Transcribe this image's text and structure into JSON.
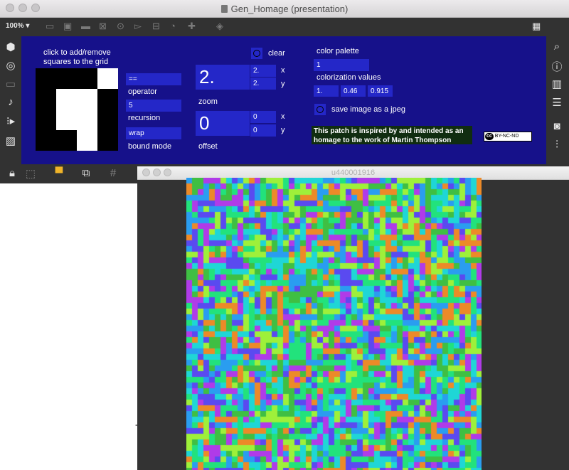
{
  "window": {
    "title": "Gen_Homage (presentation)",
    "zoom_label": "100% ▾"
  },
  "toolbar_icons": [
    "new-object-icon",
    "message-icon",
    "comment-icon",
    "button-icon",
    "toggle-icon",
    "number-icon",
    "slider-icon",
    "dial-icon",
    "add-icon",
    "paint-icon",
    "keyboard-icon"
  ],
  "left_sidebar_icons": [
    "cube-icon",
    "target-icon",
    "video-icon",
    "music-note-icon",
    "sequence-icon",
    "image-icon"
  ],
  "right_sidebar_icons": [
    "search-icon",
    "info-icon",
    "book-icon",
    "list-icon",
    "camera-icon",
    "mixer-icon"
  ],
  "bottom_bar_icons": [
    "lock-icon",
    "presentation-icon",
    "monitor-icon",
    "windows-icon",
    "grid-icon",
    "power-icon"
  ],
  "patch": {
    "grid_instructions": "click to add/remove squares to the grid",
    "grid_cells_on": [
      [
        0,
        0
      ],
      [
        1,
        0
      ],
      [
        2,
        0
      ],
      [
        0,
        1
      ],
      [
        3,
        1
      ],
      [
        0,
        2
      ],
      [
        3,
        2
      ],
      [
        0,
        3
      ],
      [
        1,
        3
      ],
      [
        3,
        3
      ]
    ],
    "operator_value": "==",
    "operator_label": "operator",
    "recursion_value": "5",
    "recursion_label": "recursion",
    "bound_mode_value": "wrap",
    "bound_mode_label": "bound mode",
    "zoom_big": "2.",
    "zoom_x": "2.",
    "zoom_y": "2.",
    "zoom_label": "zoom",
    "offset_big": "0",
    "offset_x": "0",
    "offset_y": "0",
    "offset_label": "offset",
    "x_label": "x",
    "y_label": "y",
    "clear_label": "clear",
    "color_palette_label": "color palette",
    "color_palette_value": "1",
    "colorization_label": "colorization values",
    "colorization_values": [
      "1.",
      "0.46",
      "0.915"
    ],
    "save_label": "save image as a jpeg",
    "note_text": "This patch is inspired by and intended as an homage to the work of Martin Thompson",
    "license_badge": "BY-NC-ND",
    "license_cc": "cc"
  },
  "output_window": {
    "title": "u440001916",
    "palette": [
      "#3fbf43",
      "#22e27c",
      "#9ef03a",
      "#2a9df0",
      "#5a4af0",
      "#b03be8",
      "#ec8a28",
      "#1fd6d6"
    ]
  },
  "colors": {
    "patch_bg": "#16118a",
    "field_bg": "#2427c8",
    "window_chrome": "#323232"
  }
}
